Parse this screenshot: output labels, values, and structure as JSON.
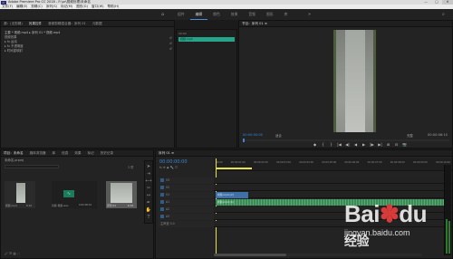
{
  "window": {
    "title": "Adobe Premiere Pro CC 2018 - F:\\pr\\视频处理\\未命名",
    "controls": [
      "—",
      "□",
      "✕"
    ]
  },
  "menu": [
    "文件(F)",
    "编辑(E)",
    "剪辑(C)",
    "序列(S)",
    "标记(M)",
    "图形(G)",
    "窗口(W)",
    "帮助(H)"
  ],
  "workspaces": [
    "组件",
    "编辑",
    "颜色",
    "效果",
    "音频",
    "图形",
    "库"
  ],
  "workspace_active": 1,
  "source_panel": {
    "tabs": [
      "源：(无剪辑)",
      "效果控件",
      "音频剪辑混合器：序列 01",
      "元数据"
    ],
    "header": "主要 * 视频.mp4 ▸ 序列 01 * 视频.mp4",
    "rows": [
      "视频效果",
      "▸ fx 运动",
      "▸ fx 不透明度",
      "▸ 时间重映射"
    ]
  },
  "mini_timeline": {
    "label": "视频.mp4",
    "timecode": "00:00"
  },
  "program": {
    "title": "节目：序列 01 ≡",
    "timecode_left": "00:00:00:00",
    "fit": "适合",
    "quality": "完整",
    "timecode_right": "00:00:06:10",
    "controls": [
      "◆",
      "{",
      "}",
      "|◀",
      "◀|",
      "◀",
      "▶",
      "|▶",
      "▶|",
      "⊞",
      "⊟",
      "📷"
    ]
  },
  "project": {
    "tabs": [
      "项目：未命名",
      "媒体浏览器",
      "库",
      "信息",
      "效果",
      "标记",
      "历史记录"
    ],
    "name": "未命名.prproj",
    "count": "3 项",
    "items": [
      {
        "name": "视频.mp4",
        "dur": "6:10"
      },
      {
        "name": "音频 视频.wav",
        "dur": "0:00:06:10"
      },
      {
        "name": "序列 01",
        "dur": "6:10"
      }
    ]
  },
  "timeline": {
    "tab": "序列 01 ≡",
    "timecode": "00:00:00:00",
    "ruler": [
      "00:00",
      "00:00:01:00",
      "00:00:02:00",
      "00:00:03:00",
      "00:00:04:00",
      "00:00:05:00",
      "00:00:06:00",
      "00:00:07:00",
      "00:00:08:00",
      "00:00:09:00",
      "00:00:10:00"
    ],
    "tracks": [
      {
        "name": "V3"
      },
      {
        "name": "V2"
      },
      {
        "name": "V1"
      },
      {
        "name": "A1"
      },
      {
        "name": "A2"
      },
      {
        "name": "A3"
      },
      {
        "name": "主声道 0.0"
      }
    ],
    "video_clip": "视频.mp4 [V]",
    "audio_clip": "视频.mp4 [A]"
  },
  "watermark": {
    "brand": "Bai",
    "suffix": "du",
    "product": "经验",
    "url": "jingyan.baidu.com"
  },
  "colors": {
    "accent": "#2d8cd6",
    "audio_clip": "#3c8a56",
    "video_clip": "#3f70a8",
    "playhead": "#e8e24a",
    "teal_clip": "#26a48a"
  }
}
